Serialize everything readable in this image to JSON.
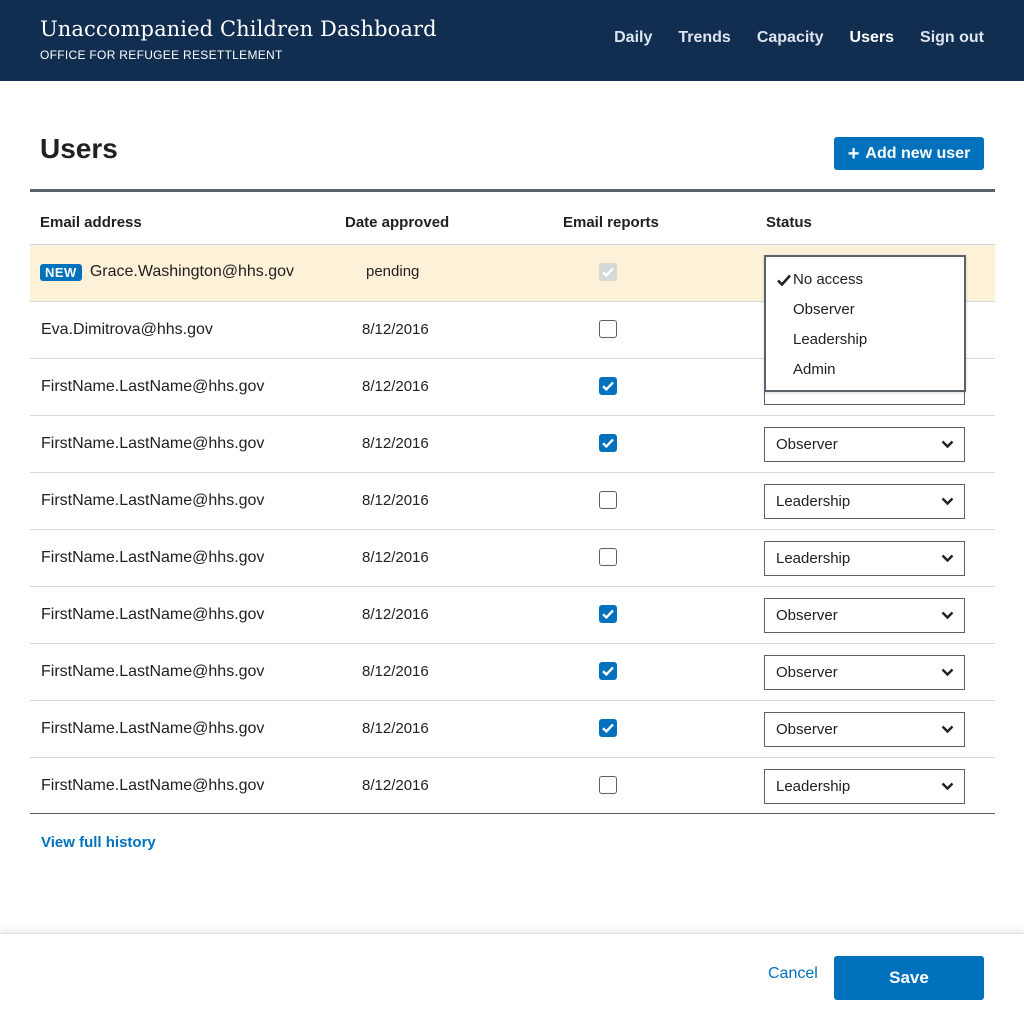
{
  "header": {
    "title": "Unaccompanied Children Dashboard",
    "subtitle": "OFFICE FOR REFUGEE RESETTLEMENT",
    "nav": [
      {
        "label": "Daily"
      },
      {
        "label": "Trends"
      },
      {
        "label": "Capacity"
      },
      {
        "label": "Users"
      },
      {
        "label": "Sign out"
      }
    ],
    "active_nav": "Users"
  },
  "page": {
    "title": "Users",
    "add_user_label": "Add new user",
    "view_history_label": "View full history"
  },
  "table": {
    "columns": [
      "Email address",
      "Date approved",
      "Email reports",
      "Status"
    ],
    "new_badge": "NEW",
    "rows": [
      {
        "email": "Grace.Washington@hhs.gov",
        "date": "pending",
        "reports": true,
        "status": "No access"
      },
      {
        "email": "Eva.Dimitrova@hhs.gov",
        "date": "8/12/2016",
        "reports": false,
        "status": ""
      },
      {
        "email": "FirstName.LastName@hhs.gov",
        "date": "8/12/2016",
        "reports": true,
        "status": ""
      },
      {
        "email": "FirstName.LastName@hhs.gov",
        "date": "8/12/2016",
        "reports": true,
        "status": "Observer"
      },
      {
        "email": "FirstName.LastName@hhs.gov",
        "date": "8/12/2016",
        "reports": false,
        "status": "Leadership"
      },
      {
        "email": "FirstName.LastName@hhs.gov",
        "date": "8/12/2016",
        "reports": false,
        "status": "Leadership"
      },
      {
        "email": "FirstName.LastName@hhs.gov",
        "date": "8/12/2016",
        "reports": true,
        "status": "Observer"
      },
      {
        "email": "FirstName.LastName@hhs.gov",
        "date": "8/12/2016",
        "reports": true,
        "status": "Observer"
      },
      {
        "email": "FirstName.LastName@hhs.gov",
        "date": "8/12/2016",
        "reports": true,
        "status": "Observer"
      },
      {
        "email": "FirstName.LastName@hhs.gov",
        "date": "8/12/2016",
        "reports": false,
        "status": "Leadership"
      }
    ]
  },
  "status_menu": {
    "options": [
      "No access",
      "Observer",
      "Leadership",
      "Admin"
    ],
    "selected": "No access"
  },
  "footer": {
    "cancel_label": "Cancel",
    "save_label": "Save"
  },
  "colors": {
    "header_bg": "#112e51",
    "primary": "#0071bc",
    "new_row_bg": "#fdf1d8"
  }
}
